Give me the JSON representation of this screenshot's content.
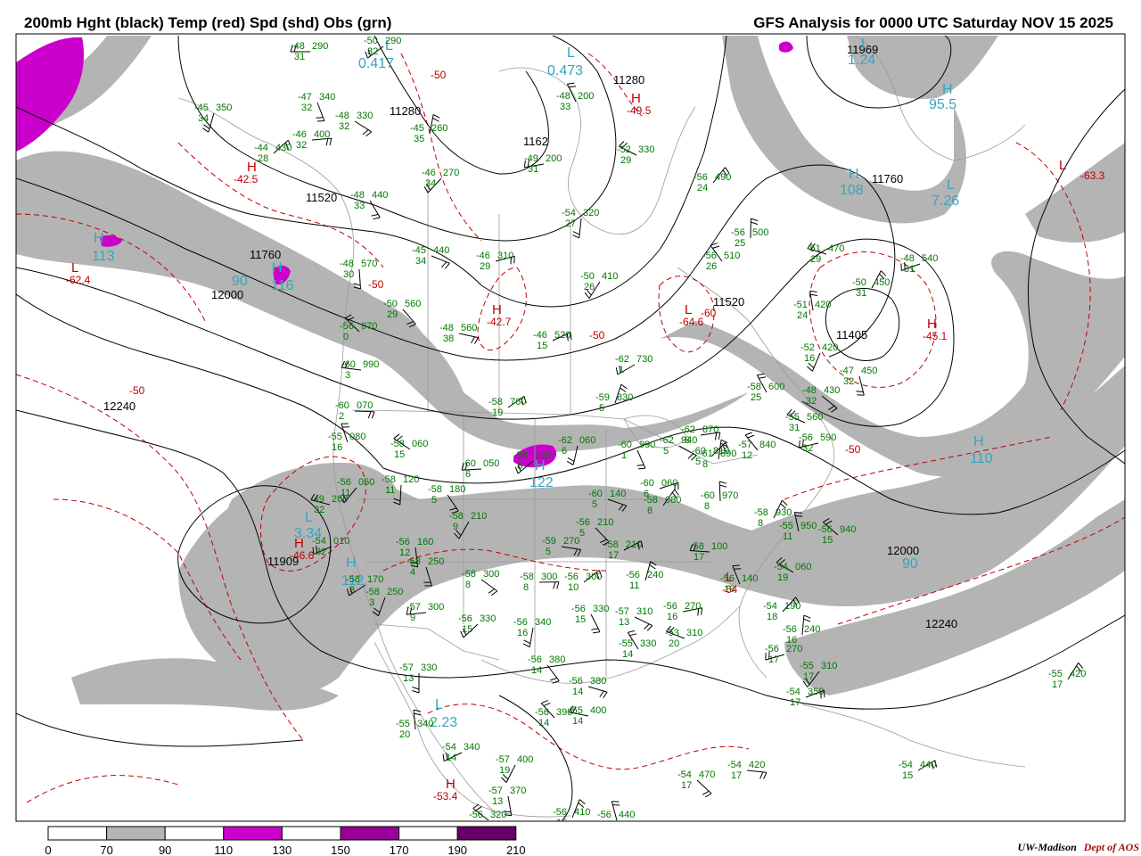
{
  "header": {
    "title_left": "200mb Hght (black) Temp (red) Spd (shd) Obs (grn)",
    "title_right": "GFS Analysis for 0000 UTC Saturday  NOV 15 2025"
  },
  "footer": {
    "credit_org": "UW-Madison",
    "credit_dept": "Dept of AOS"
  },
  "colors": {
    "height_contours": "#000000",
    "temp_contours": "#c00000",
    "obs_text": "#007800",
    "speed_extrema": "#35a5c0",
    "speed_70_90": "#b4b4b4",
    "speed_110_130": "#cc00cc",
    "speed_150_170": "#990099",
    "speed_190_210": "#660066",
    "map_lines": "#9a9a9a"
  },
  "colorbar": {
    "ticks": [
      "0",
      "70",
      "90",
      "110",
      "130",
      "150",
      "170",
      "190",
      "210"
    ]
  },
  "height_labels": [
    "11280",
    "11280",
    "11520",
    "11760",
    "12000",
    "12240",
    "11909",
    "11520",
    "11760",
    "12000",
    "12240",
    "11969",
    "11405",
    "1162"
  ],
  "temp_labels": [
    "-50",
    "-50",
    "-50",
    "-50",
    "-60",
    "-50"
  ],
  "pressure_centers": [
    {
      "kind": "H",
      "value": "-42.5"
    },
    {
      "kind": "L",
      "value": "-62.4"
    },
    {
      "kind": "H",
      "value": "-42.7"
    },
    {
      "kind": "L",
      "value": "-64.6"
    },
    {
      "kind": "H",
      "value": "-45.1"
    },
    {
      "kind": "H",
      "value": "-49.5"
    },
    {
      "kind": "H",
      "value": "-46.6"
    },
    {
      "kind": "H",
      "value": "-53.4"
    },
    {
      "kind": "L",
      "value": "-63.3"
    },
    {
      "kind": "L",
      "value": "-64"
    }
  ],
  "speed_centers": [
    {
      "kind": "L",
      "value": "0.417"
    },
    {
      "kind": "L",
      "value": "0.473"
    },
    {
      "kind": "L",
      "value": "1.24"
    },
    {
      "kind": "H",
      "value": "95.5"
    },
    {
      "kind": "H",
      "value": "108"
    },
    {
      "kind": "L",
      "value": "7.26"
    },
    {
      "kind": "H",
      "value": "113"
    },
    {
      "kind": "H",
      "value": "116"
    },
    {
      "kind": "L",
      "value": "3.34"
    },
    {
      "kind": "H",
      "value": "122"
    },
    {
      "kind": "L",
      "value": "2.23"
    },
    {
      "kind": "H",
      "value": "110"
    },
    {
      "kind": "H",
      "value": "112"
    },
    {
      "kind": "H",
      "value": "90"
    },
    {
      "kind": "H",
      "value": "90"
    }
  ],
  "observations": [
    {
      "t": "-48",
      "h": "290",
      "d": "31"
    },
    {
      "t": "-50",
      "h": "290",
      "d": "32"
    },
    {
      "t": "-45",
      "h": "350",
      "d": "34"
    },
    {
      "t": "-47",
      "h": "340",
      "d": "32"
    },
    {
      "t": "-48",
      "h": "330",
      "d": "32"
    },
    {
      "t": "-46",
      "h": "400",
      "d": "32"
    },
    {
      "t": "-44",
      "h": "430",
      "d": "28"
    },
    {
      "t": "-45",
      "h": "260",
      "d": "35"
    },
    {
      "t": "-48",
      "h": "200",
      "d": "33"
    },
    {
      "t": "-52",
      "h": "330",
      "d": "29"
    },
    {
      "t": "-49",
      "h": "200",
      "d": "31"
    },
    {
      "t": "-46",
      "h": "270",
      "d": "34"
    },
    {
      "t": "-54",
      "h": "320",
      "d": "27"
    },
    {
      "t": "-48",
      "h": "440",
      "d": "33"
    },
    {
      "t": "-45",
      "h": "440",
      "d": "34"
    },
    {
      "t": "-46",
      "h": "310",
      "d": "29"
    },
    {
      "t": "-56",
      "h": "490",
      "d": "24"
    },
    {
      "t": "-56",
      "h": "500",
      "d": "25"
    },
    {
      "t": "-56",
      "h": "510",
      "d": "26"
    },
    {
      "t": "-51",
      "h": "470",
      "d": "29"
    },
    {
      "t": "-48",
      "h": "540",
      "d": "31"
    },
    {
      "t": "-50",
      "h": "410",
      "d": "26"
    },
    {
      "t": "-48",
      "h": "570",
      "d": "30"
    },
    {
      "t": "-50",
      "h": "560",
      "d": "29"
    },
    {
      "t": "-48",
      "h": "560",
      "d": "38"
    },
    {
      "t": "-46",
      "h": "520",
      "d": "15"
    },
    {
      "t": "-50",
      "h": "450",
      "d": "31"
    },
    {
      "t": "-51",
      "h": "420",
      "d": "24"
    },
    {
      "t": "-56",
      "h": "970",
      "d": "0"
    },
    {
      "t": "-60",
      "h": "990",
      "d": "3"
    },
    {
      "t": "-62",
      "h": "730",
      "d": "1"
    },
    {
      "t": "-52",
      "h": "420",
      "d": "16"
    },
    {
      "t": "-47",
      "h": "450",
      "d": "32"
    },
    {
      "t": "-48",
      "h": "430",
      "d": "32"
    },
    {
      "t": "-60",
      "h": "070",
      "d": "2"
    },
    {
      "t": "-58",
      "h": "760",
      "d": "19"
    },
    {
      "t": "-59",
      "h": "830",
      "d": "5"
    },
    {
      "t": "-55",
      "h": "080",
      "d": "16"
    },
    {
      "t": "-58",
      "h": "060",
      "d": "15"
    },
    {
      "t": "-60",
      "h": "050",
      "d": "6"
    },
    {
      "t": "-58",
      "h": "100",
      "d": "8"
    },
    {
      "t": "-62",
      "h": "060",
      "d": "6"
    },
    {
      "t": "-60",
      "h": "990",
      "d": "1"
    },
    {
      "t": "-62",
      "h": "940",
      "d": "5"
    },
    {
      "t": "-62",
      "h": "870",
      "d": "8"
    },
    {
      "t": "-60",
      "h": "810",
      "d": "5"
    },
    {
      "t": "-61",
      "h": "890",
      "d": "8"
    },
    {
      "t": "-58",
      "h": "600",
      "d": "25"
    },
    {
      "t": "-55",
      "h": "560",
      "d": "31"
    },
    {
      "t": "-56",
      "h": "590",
      "d": "32"
    },
    {
      "t": "-56",
      "h": "050",
      "d": "11"
    },
    {
      "t": "-58",
      "h": "120",
      "d": "11"
    },
    {
      "t": "-58",
      "h": "180",
      "d": "5"
    },
    {
      "t": "-60",
      "h": "140",
      "d": "5"
    },
    {
      "t": "-60",
      "h": "060",
      "d": "6"
    },
    {
      "t": "-58",
      "h": "080",
      "d": "8"
    },
    {
      "t": "-60",
      "h": "970",
      "d": "8"
    },
    {
      "t": "-57",
      "h": "840",
      "d": "12"
    },
    {
      "t": "-49",
      "h": "260",
      "d": "32"
    },
    {
      "t": "-54",
      "h": "010",
      "d": "32"
    },
    {
      "t": "-58",
      "h": "210",
      "d": "9"
    },
    {
      "t": "-56",
      "h": "160",
      "d": "12"
    },
    {
      "t": "-56",
      "h": "210",
      "d": "5"
    },
    {
      "t": "-59",
      "h": "270",
      "d": "5"
    },
    {
      "t": "-58",
      "h": "210",
      "d": "17"
    },
    {
      "t": "-58",
      "h": "930",
      "d": "8"
    },
    {
      "t": "-55",
      "h": "950",
      "d": "11"
    },
    {
      "t": "-56",
      "h": "940",
      "d": "15"
    },
    {
      "t": "-58",
      "h": "100",
      "d": "17"
    },
    {
      "t": "-58",
      "h": "170",
      "d": "3"
    },
    {
      "t": "-58",
      "h": "250",
      "d": "3"
    },
    {
      "t": "-58",
      "h": "250",
      "d": "4"
    },
    {
      "t": "-58",
      "h": "300",
      "d": "8"
    },
    {
      "t": "-58",
      "h": "300",
      "d": "8"
    },
    {
      "t": "-56",
      "h": "300",
      "d": "10"
    },
    {
      "t": "-56",
      "h": "240",
      "d": "11"
    },
    {
      "t": "-56",
      "h": "140",
      "d": "19"
    },
    {
      "t": "-54",
      "h": "060",
      "d": "19"
    },
    {
      "t": "-57",
      "h": "300",
      "d": "9"
    },
    {
      "t": "-56",
      "h": "330",
      "d": "15"
    },
    {
      "t": "-56",
      "h": "340",
      "d": "16"
    },
    {
      "t": "-56",
      "h": "330",
      "d": "15"
    },
    {
      "t": "-57",
      "h": "310",
      "d": "13"
    },
    {
      "t": "-56",
      "h": "270",
      "d": "16"
    },
    {
      "t": "-54",
      "h": "190",
      "d": "18"
    },
    {
      "t": "-56",
      "h": "240",
      "d": "16"
    },
    {
      "t": "-55",
      "h": "330",
      "d": "14"
    },
    {
      "t": "-53",
      "h": "310",
      "d": "20"
    },
    {
      "t": "-56",
      "h": "270",
      "d": "17"
    },
    {
      "t": "-55",
      "h": "310",
      "d": "17"
    },
    {
      "t": "-57",
      "h": "330",
      "d": "13"
    },
    {
      "t": "-56",
      "h": "380",
      "d": "14"
    },
    {
      "t": "-56",
      "h": "380",
      "d": "14"
    },
    {
      "t": "-54",
      "h": "350",
      "d": "17"
    },
    {
      "t": "-55",
      "h": "420",
      "d": "17"
    },
    {
      "t": "-55",
      "h": "340",
      "d": "20"
    },
    {
      "t": "-56",
      "h": "390",
      "d": "14"
    },
    {
      "t": "-55",
      "h": "400",
      "d": "14"
    },
    {
      "t": "-54",
      "h": "340",
      "d": "14"
    },
    {
      "t": "-57",
      "h": "400",
      "d": "19"
    },
    {
      "t": "-57",
      "h": "370",
      "d": "13"
    },
    {
      "t": "-54",
      "h": "470",
      "d": "17"
    },
    {
      "t": "-54",
      "h": "420",
      "d": "17"
    },
    {
      "t": "-54",
      "h": "440",
      "d": "15"
    },
    {
      "t": "-56",
      "h": "410",
      "d": "15"
    },
    {
      "t": "-56",
      "h": "440",
      "d": "15"
    },
    {
      "t": "-56",
      "h": "320",
      "d": "17"
    }
  ]
}
